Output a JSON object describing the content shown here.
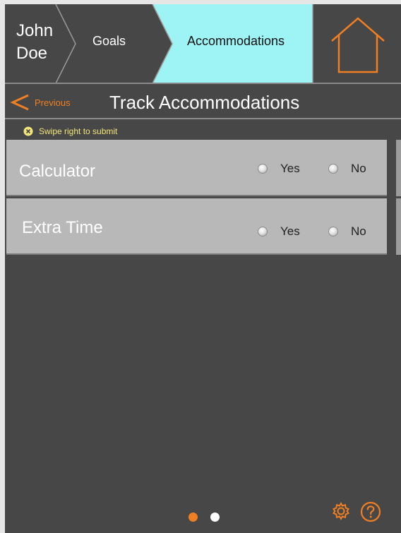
{
  "breadcrumb": {
    "student_name": "John Doe",
    "goals_label": "Goals",
    "accommodations_label": "Accommodations",
    "active_color": "#9ef3f5",
    "home_icon": "home-icon"
  },
  "titlebar": {
    "previous_label": "Previous",
    "title": "Track Accommodations",
    "accent_color": "#f07f24"
  },
  "hint": {
    "text": "Swipe right to submit",
    "icon": "close-circle-icon"
  },
  "accommodations": [
    {
      "label": "Calculator",
      "yes_label": "Yes",
      "no_label": "No"
    },
    {
      "label": "Extra Time",
      "yes_label": "Yes",
      "no_label": "No"
    }
  ],
  "pagination": {
    "pages": 2,
    "current": 1
  },
  "footer": {
    "settings_icon": "gear-icon",
    "help_icon": "help-icon"
  }
}
